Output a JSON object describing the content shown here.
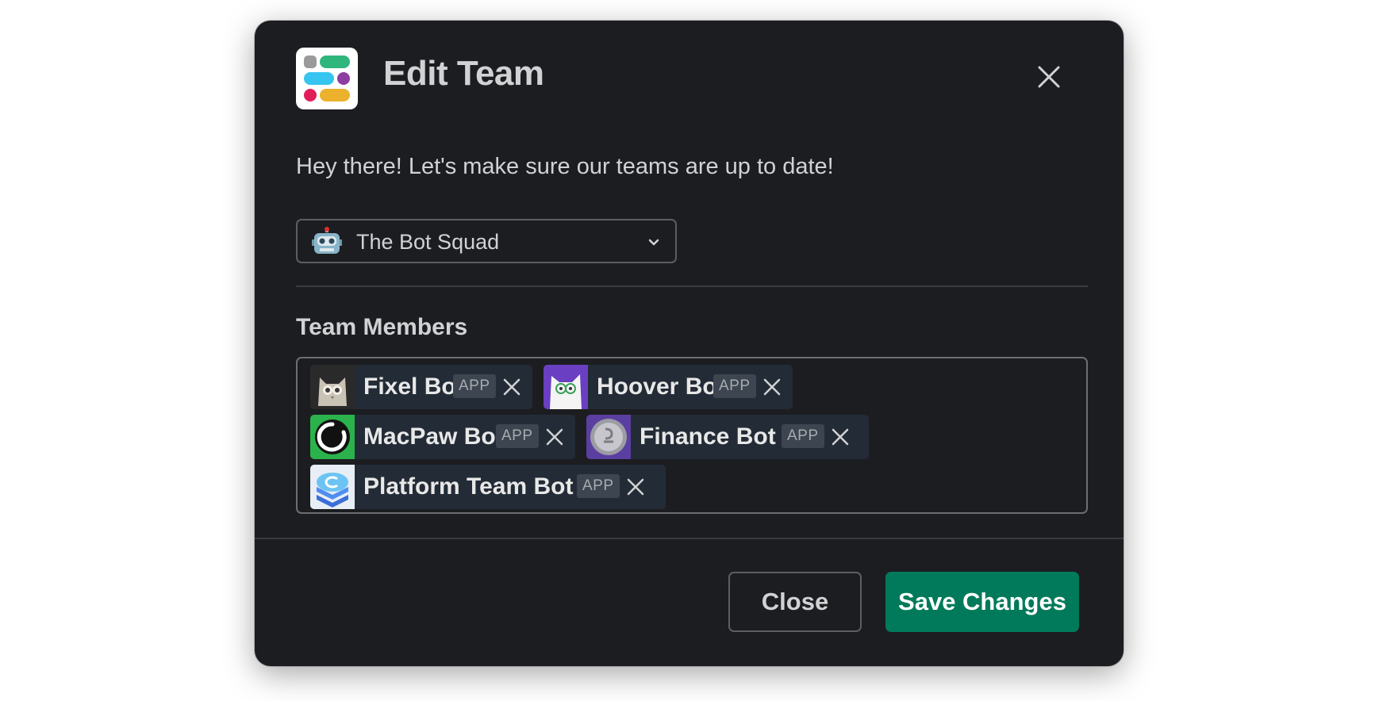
{
  "modal": {
    "title": "Edit Team",
    "intro": "Hey there! Let's make sure our teams are up to date!",
    "close_icon": "close-icon",
    "logo_icon": "app-logo-icon"
  },
  "team_select": {
    "selected": "The Bot Squad",
    "icon": "robot-face-icon"
  },
  "members_section": {
    "label": "Team Members",
    "members": [
      {
        "name": "Fixel Bot",
        "badge": "APP"
      },
      {
        "name": "Hoover Bot",
        "badge": "APP"
      },
      {
        "name": "MacPaw Bot",
        "badge": "APP"
      },
      {
        "name": "Finance Bot",
        "badge": "APP"
      },
      {
        "name": "Platform Team Bot",
        "badge": "APP"
      }
    ]
  },
  "footer": {
    "close_label": "Close",
    "save_label": "Save Changes"
  },
  "colors": {
    "modal_bg": "#1c1d21",
    "accent_green": "#007a5a",
    "chip_bg": "#232c36"
  }
}
